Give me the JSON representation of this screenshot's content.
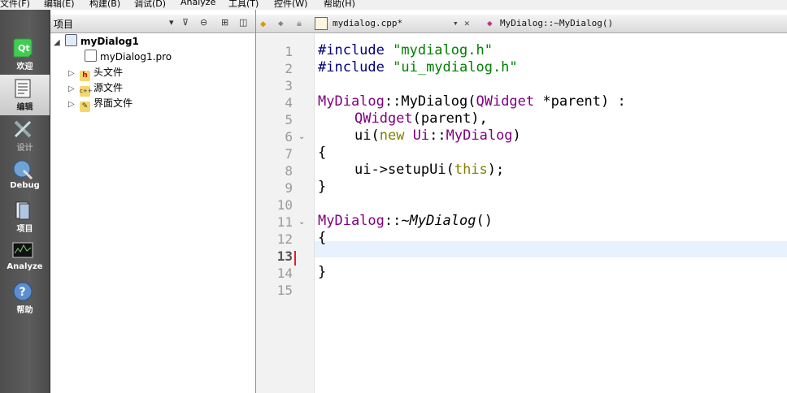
{
  "menu": [
    "文件(F)",
    "编辑(E)",
    "构建(B)",
    "调试(D)",
    "Analyze",
    "工具(T)",
    "控件(W)",
    "帮助(H)"
  ],
  "modes": [
    {
      "label": "欢迎",
      "icon": "qt-logo-icon"
    },
    {
      "label": "编辑",
      "icon": "edit-document-icon"
    },
    {
      "label": "设计",
      "icon": "design-tools-icon"
    },
    {
      "label": "Debug",
      "icon": "debug-bug-icon"
    },
    {
      "label": "项目",
      "icon": "project-folder-icon"
    },
    {
      "label": "Analyze",
      "icon": "analyze-monitor-icon"
    },
    {
      "label": "帮助",
      "icon": "help-question-icon"
    }
  ],
  "project_pane": {
    "title": "项目",
    "tree": {
      "root": "myDialog1",
      "children": [
        "myDialog1.pro",
        "头文件",
        "源文件",
        "界面文件"
      ]
    }
  },
  "editor": {
    "file_tab": "mydialog.cpp*",
    "symbol": "MyDialog::~MyDialog()",
    "current_line": 13
  },
  "code": {
    "l1": [
      "#include ",
      "\"mydialog.h\""
    ],
    "l2": [
      "#include ",
      "\"ui_mydialog.h\""
    ],
    "l4": [
      "MyDialog",
      "::MyDialog(",
      "QWidget",
      " *parent) :"
    ],
    "l5": [
      "QWidget",
      "(parent),"
    ],
    "l6": [
      "ui(",
      "new",
      " ",
      "Ui",
      "::",
      "MyDialog",
      ")"
    ],
    "l7": "{",
    "l8": [
      "ui->setupUi(",
      "this",
      ");"
    ],
    "l9": "}",
    "l11": [
      "MyDialog",
      "::~",
      "MyDialog",
      "()"
    ],
    "l12": "{",
    "l14": "}"
  }
}
